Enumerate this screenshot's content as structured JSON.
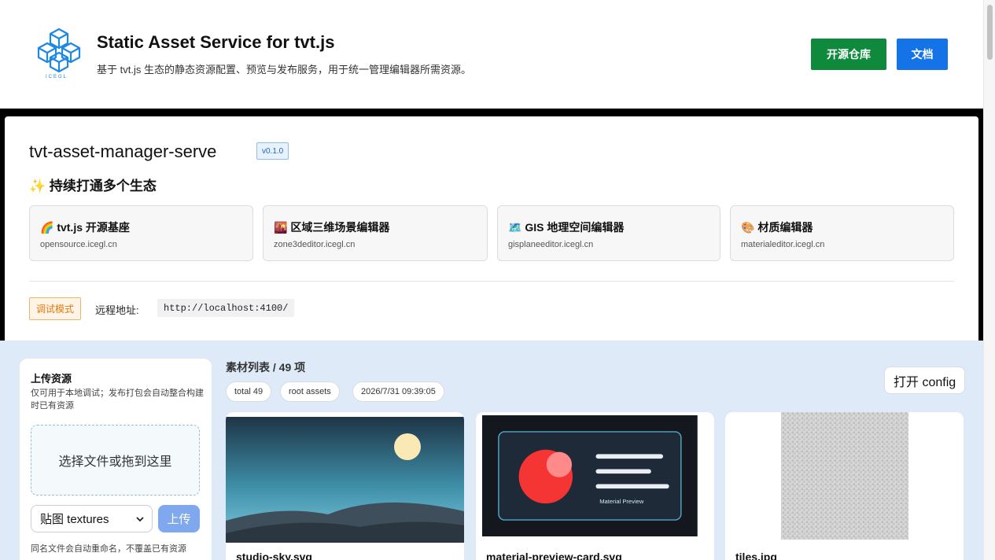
{
  "header": {
    "title": "Static Asset Service for tvt.js",
    "subtitle": "基于 tvt.js 生态的静态资源配置、预览与发布服务，用于统一管理编辑器所需资源。",
    "logo_text": "ICEGL",
    "repo_button": "开源仓库",
    "docs_button": "文档"
  },
  "info": {
    "package_name": "tvt-asset-manager-serve",
    "version": "v0.1.0",
    "ecosystem_title": "✨ 持续打通多个生态",
    "ecosystems": [
      {
        "name": "🌈 tvt.js 开源基座",
        "host": "opensource.icegl.cn"
      },
      {
        "name": "🌇 区域三维场景编辑器",
        "host": "zone3deditor.icegl.cn"
      },
      {
        "name": "🗺️ GIS 地理空间编辑器",
        "host": "gisplaneeditor.icegl.cn"
      },
      {
        "name": "🎨 材质编辑器",
        "host": "materialeditor.icegl.cn"
      }
    ],
    "debug_badge": "调试模式",
    "remote_label": "远程地址:",
    "remote_url": "http://localhost:4100/"
  },
  "upload": {
    "title": "上传资源",
    "description": "仅可用于本地调试；发布打包会自动整合构建时已有资源",
    "dropzone": "选择文件或拖到这里",
    "select_value": "贴图 textures",
    "upload_button": "上传",
    "note": "同名文件会自动重命名，不覆盖已有资源"
  },
  "assets": {
    "title": "素材列表 / 49 项",
    "chips": [
      "total 49",
      "root assets",
      "2026/7/31 09:39:05"
    ],
    "config_button": "打开 config",
    "cards": [
      {
        "name": "studio-sky.svg"
      },
      {
        "name": "material-preview-card.svg",
        "preview_label": "Material Preview"
      },
      {
        "name": "tiles.jpg"
      }
    ]
  },
  "colors": {
    "repo_green": "#0f8a3d",
    "docs_blue": "#1473e6",
    "workarea_bg": "#dfeaf8",
    "debug_orange": "#e07b12"
  }
}
